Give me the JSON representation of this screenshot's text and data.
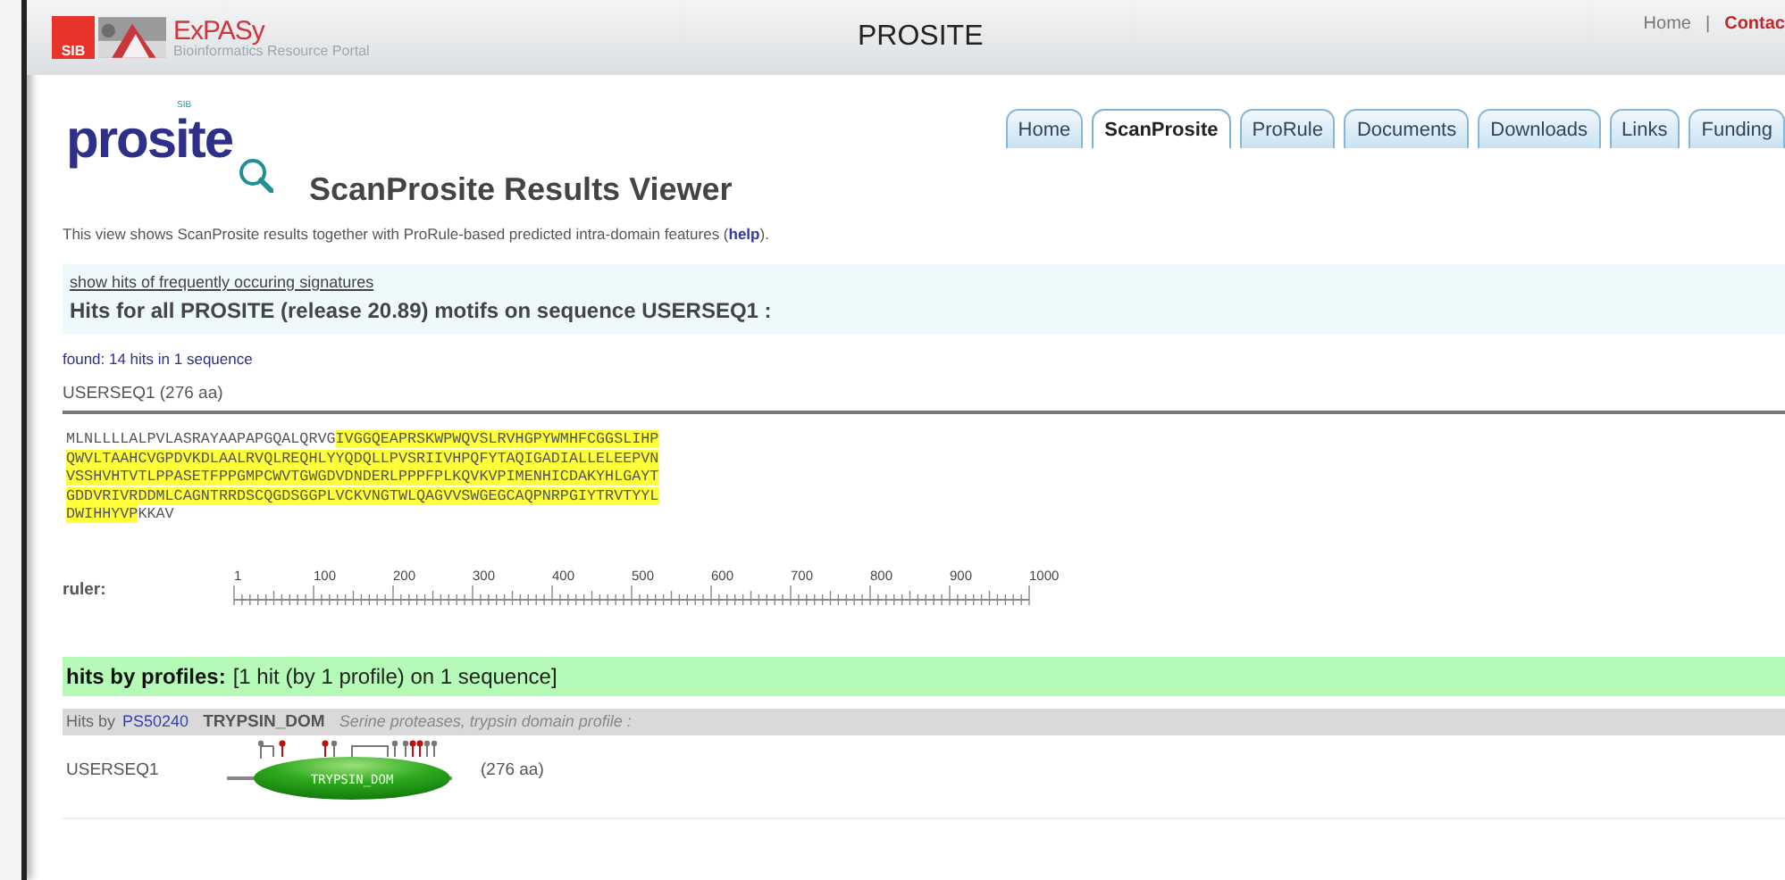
{
  "header": {
    "sib_logo": "SIB",
    "brand": "ExPASy",
    "brand_subtitle": "Bioinformatics Resource Portal",
    "title": "PROSITE",
    "links": [
      "Home",
      "Contac"
    ],
    "separator": "|"
  },
  "logo": {
    "text": "prosite",
    "tag": "SIB"
  },
  "tabs": [
    {
      "label": "Home",
      "selected": false
    },
    {
      "label": "ScanProsite",
      "selected": true
    },
    {
      "label": "ProRule",
      "selected": false
    },
    {
      "label": "Documents",
      "selected": false
    },
    {
      "label": "Downloads",
      "selected": false
    },
    {
      "label": "Links",
      "selected": false
    },
    {
      "label": "Funding",
      "selected": false
    }
  ],
  "page_title": "ScanProsite Results Viewer",
  "intro": {
    "text": "This view shows ScanProsite results together with ProRule-based predicted intra-domain features (",
    "link": "help",
    "after": ")."
  },
  "hits_box": {
    "link": "show hits of frequently occuring signatures",
    "heading": "Hits for all PROSITE (release 20.89) motifs on sequence USERSEQ1 :"
  },
  "found": "found: 14 hits in 1 sequence",
  "sequence": {
    "name": "USERSEQ1 (276 aa)",
    "lines": [
      [
        {
          "text": "MLNLLLLALPVLASRAYAAPAPGQALQRVG",
          "highlighted": false
        },
        {
          "text": "IVGGQEAPRSKWPWQVSLRVHGPYWMHFCGGSLIHP",
          "highlighted": true
        }
      ],
      [
        {
          "text": "QWVLTAAHCVGPDVKDLAALRVQLREQHLYYQDQLLPVSRIIVHPQFYTAQIGADIALLELEEPVN",
          "highlighted": true
        }
      ],
      [
        {
          "text": "VSSHVHTVTLPPASETFPPGMPCWVTGWGDVDNDERLPPPFPLKQVKVPIMENHICDAKYHLGAYT",
          "highlighted": true
        }
      ],
      [
        {
          "text": "GDDVRIVRDDMLCAGNTRRDSCQGDSGGPLVCKVNGTWLQAGVVSWGEGCAQPNRPGIYTRVTYYL",
          "highlighted": true
        }
      ],
      [
        {
          "text": "DWIHHYVP",
          "highlighted": true
        },
        {
          "text": "KKAV",
          "highlighted": false
        }
      ]
    ]
  },
  "ruler": {
    "label": "ruler:",
    "ticks": [
      "1",
      "100",
      "200",
      "300",
      "400",
      "500",
      "600",
      "700",
      "800",
      "900",
      "1000"
    ]
  },
  "profiles": {
    "heading": "hits by profiles:",
    "summary": "[1 hit (by 1 profile) on 1 sequence]",
    "hit": {
      "prefix": "Hits by",
      "accession": "PS50240",
      "name": "TRYPSIN_DOM",
      "description": "Serine proteases, trypsin domain profile :"
    },
    "row": {
      "sequence": "USERSEQ1",
      "domain": "TRYPSIN_DOM",
      "length": "(276 aa)"
    }
  }
}
